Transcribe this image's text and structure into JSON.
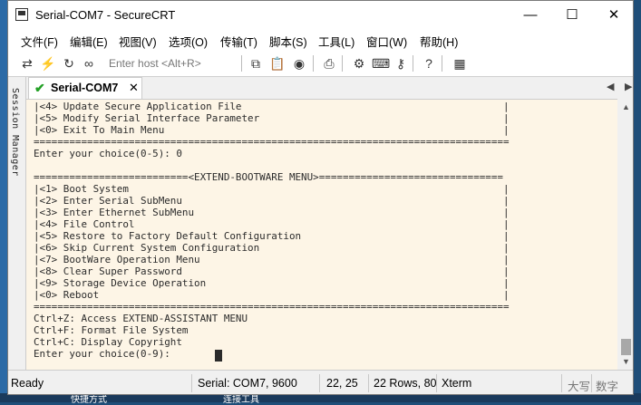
{
  "window": {
    "title": "Serial-COM7 - SecureCRT"
  },
  "menu": [
    "文件(F)",
    "编辑(E)",
    "视图(V)",
    "选项(O)",
    "传输(T)",
    "脚本(S)",
    "工具(L)",
    "窗口(W)",
    "帮助(H)"
  ],
  "toolbar": {
    "host_placeholder": "Enter host <Alt+R>"
  },
  "session_manager": {
    "label": "Session Manager"
  },
  "tab": {
    "label": "Serial-COM7"
  },
  "terminal": {
    "lines": [
      "|<4> Update Secure Application File                                            |",
      "|<5> Modify Serial Interface Parameter                                         |",
      "|<0> Exit To Main Menu                                                         |",
      "================================================================================",
      "Enter your choice(0-5): 0",
      "",
      "==========================<EXTEND-BOOTWARE MENU>===============================",
      "|<1> Boot System                                                               |",
      "|<2> Enter Serial SubMenu                                                      |",
      "|<3> Enter Ethernet SubMenu                                                    |",
      "|<4> File Control                                                              |",
      "|<5> Restore to Factory Default Configuration                                  |",
      "|<6> Skip Current System Configuration                                         |",
      "|<7> BootWare Operation Menu                                                   |",
      "|<8> Clear Super Password                                                      |",
      "|<9> Storage Device Operation                                                  |",
      "|<0> Reboot                                                                    |",
      "================================================================================",
      "Ctrl+Z: Access EXTEND-ASSISTANT MENU",
      "Ctrl+F: Format File System",
      "Ctrl+C: Display Copyright",
      "Enter your choice(0-9): "
    ]
  },
  "status": {
    "ready": "Ready",
    "connection": "Serial: COM7, 9600",
    "cursor_pos": "22,  25",
    "size": "22 Rows, 80",
    "emulation": "Xterm",
    "caps": "大写",
    "num": "数字"
  },
  "desktop": {
    "item1": "快捷方式",
    "item2": "连接工具"
  }
}
